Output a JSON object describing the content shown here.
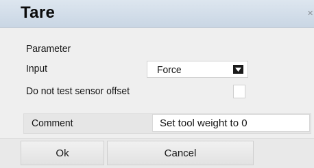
{
  "dialog": {
    "title": "Tare",
    "section_label": "Parameter",
    "input_label": "Input",
    "input_value": "Force",
    "sensor_offset_label": "Do not test sensor offset",
    "sensor_offset_checked": false,
    "comment_label": "Comment",
    "comment_value": "Set tool weight to 0",
    "ok_label": "Ok",
    "cancel_label": "Cancel"
  },
  "icons": {
    "dropdown": "triangle-down-icon",
    "close": "close-icon"
  },
  "colors": {
    "titlebar": "#c9d6e4",
    "background": "#efefef"
  }
}
